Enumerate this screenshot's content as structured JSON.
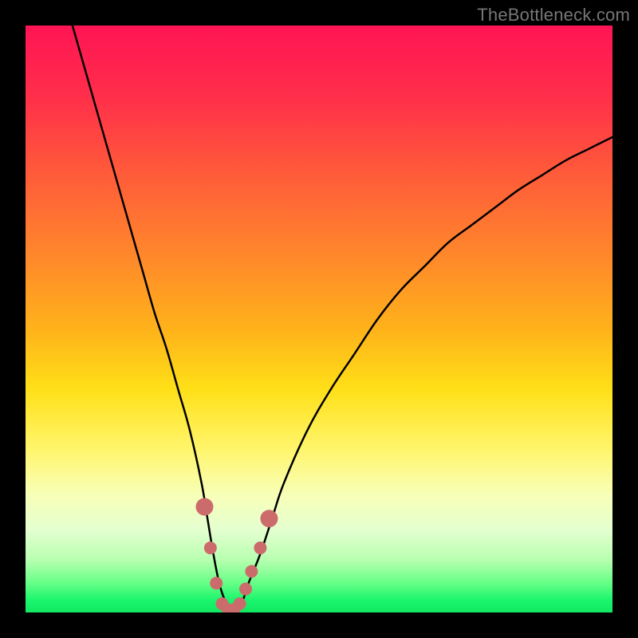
{
  "watermark_text": "TheBottleneck.com",
  "chart_data": {
    "type": "line",
    "title": "",
    "xlabel": "",
    "ylabel": "",
    "xlim": [
      0,
      100
    ],
    "ylim": [
      0,
      100
    ],
    "legend": false,
    "gradient_description": "vertical rainbow from red (top, high bottleneck) through orange, yellow, pale green to green (bottom, low bottleneck)",
    "series": [
      {
        "name": "bottleneck-curve",
        "color": "#000000",
        "x": [
          8,
          10,
          12,
          14,
          16,
          18,
          20,
          22,
          24,
          26,
          28,
          30,
          31,
          32,
          33,
          34,
          35,
          36,
          37,
          38,
          40,
          42,
          44,
          48,
          52,
          56,
          60,
          64,
          68,
          72,
          76,
          80,
          84,
          88,
          92,
          96,
          100
        ],
        "y": [
          100,
          93,
          86,
          79,
          72,
          65,
          58,
          51,
          45,
          38,
          31,
          22,
          16,
          10,
          5,
          2,
          0.5,
          0.5,
          2,
          5,
          10,
          16,
          22,
          31,
          38,
          44,
          50,
          55,
          59,
          63,
          66,
          69,
          72,
          74.5,
          77,
          79,
          81
        ]
      }
    ],
    "markers": {
      "name": "highlighted-near-minimum",
      "color": "#cc6b6b",
      "endpoints_radius_px": 11,
      "interior_radius_px": 8,
      "points": [
        {
          "x": 30.5,
          "y": 18
        },
        {
          "x": 31.5,
          "y": 11
        },
        {
          "x": 32.5,
          "y": 5
        },
        {
          "x": 33.5,
          "y": 1.5
        },
        {
          "x": 34.5,
          "y": 0.5
        },
        {
          "x": 35.5,
          "y": 0.5
        },
        {
          "x": 36.5,
          "y": 1.5
        },
        {
          "x": 37.5,
          "y": 4
        },
        {
          "x": 38.5,
          "y": 7
        },
        {
          "x": 40.0,
          "y": 11
        },
        {
          "x": 41.5,
          "y": 16
        }
      ]
    }
  }
}
